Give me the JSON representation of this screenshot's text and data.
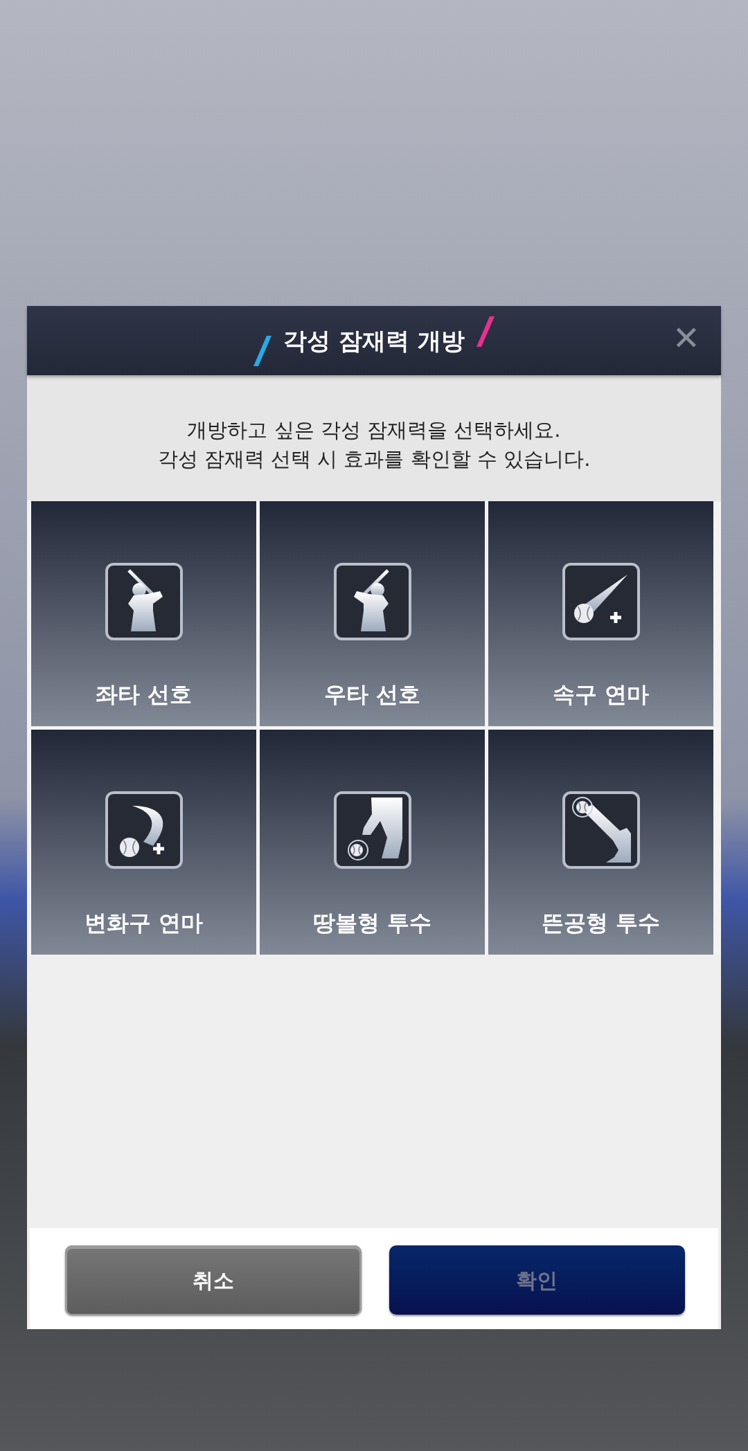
{
  "dialog": {
    "title": "각성 잠재력 개방",
    "close_label": "✕",
    "message": [
      "개방하고 싶은 각성 잠재력을 선택하세요.",
      "각성 잠재력 선택 시 효과를 확인할 수 있습니다."
    ],
    "options": [
      {
        "label": "좌타 선호",
        "kind": "batter_left",
        "selected": false
      },
      {
        "label": "우타 선호",
        "kind": "batter_right",
        "selected": false
      },
      {
        "label": "속구 연마",
        "kind": "fastball",
        "selected": false
      },
      {
        "label": "변화구 연마",
        "kind": "breaking",
        "selected": false
      },
      {
        "label": "땅볼형 투수",
        "kind": "groundball",
        "selected": false
      },
      {
        "label": "뜬공형 투수",
        "kind": "flyball",
        "selected": false
      }
    ],
    "buttons": [
      {
        "label": "취소",
        "kind": "cancel",
        "disabled": false
      },
      {
        "label": "확인",
        "kind": "confirm",
        "disabled": true
      }
    ]
  }
}
